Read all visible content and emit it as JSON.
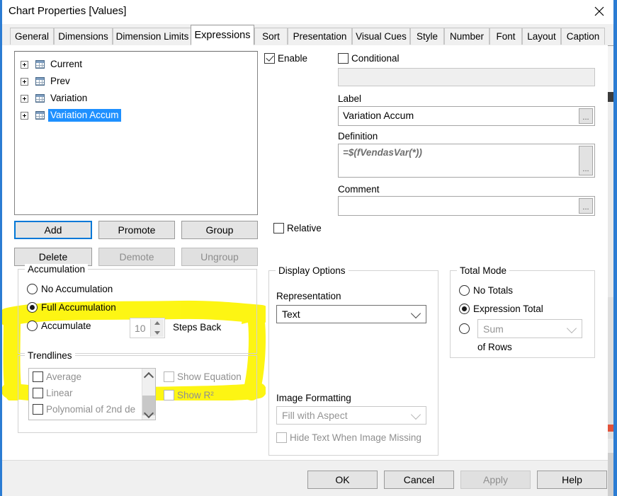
{
  "window": {
    "title": "Chart Properties [Values]",
    "close_icon": "close-icon"
  },
  "tabs": [
    {
      "label": "General",
      "active": false
    },
    {
      "label": "Dimensions",
      "active": false
    },
    {
      "label": "Dimension Limits",
      "active": false
    },
    {
      "label": "Expressions",
      "active": true
    },
    {
      "label": "Sort",
      "active": false
    },
    {
      "label": "Presentation",
      "active": false
    },
    {
      "label": "Visual Cues",
      "active": false
    },
    {
      "label": "Style",
      "active": false
    },
    {
      "label": "Number",
      "active": false
    },
    {
      "label": "Font",
      "active": false
    },
    {
      "label": "Layout",
      "active": false
    },
    {
      "label": "Caption",
      "active": false
    }
  ],
  "expression_tree": {
    "items": [
      {
        "label": "Current",
        "selected": false
      },
      {
        "label": "Prev",
        "selected": false
      },
      {
        "label": "Variation",
        "selected": false
      },
      {
        "label": "Variation Accum",
        "selected": true
      }
    ]
  },
  "action_buttons": {
    "add": "Add",
    "promote": "Promote",
    "group": "Group",
    "delete": "Delete",
    "demote": "Demote",
    "ungroup": "Ungroup"
  },
  "expression_detail": {
    "enable_label": "Enable",
    "enable_checked": true,
    "conditional_label": "Conditional",
    "conditional_checked": false,
    "conditional_value": "",
    "label_caption": "Label",
    "label_value": "Variation Accum",
    "definition_caption": "Definition",
    "definition_value": "=$(fVendasVar(*))",
    "comment_caption": "Comment",
    "comment_value": "",
    "ellipsis": "...",
    "relative_label": "Relative",
    "relative_checked": false
  },
  "accumulation": {
    "title": "Accumulation",
    "options": [
      {
        "label": "No Accumulation",
        "selected": false
      },
      {
        "label": "Full Accumulation",
        "selected": true
      },
      {
        "label": "Accumulate",
        "selected": false
      }
    ],
    "steps_value": "10",
    "steps_label": "Steps Back",
    "highlight_color": "#fdf500"
  },
  "trendlines": {
    "title": "Trendlines",
    "items": [
      {
        "label": "Average",
        "checked": false
      },
      {
        "label": "Linear",
        "checked": false
      },
      {
        "label": "Polynomial of 2nd de",
        "checked": false
      }
    ],
    "show_equation_label": "Show Equation",
    "show_equation_checked": false,
    "show_r2_label": "Show R²",
    "show_r2_checked": false
  },
  "display_options": {
    "title": "Display Options",
    "representation_caption": "Representation",
    "representation_value": "Text",
    "image_formatting_caption": "Image Formatting",
    "image_formatting_value": "Fill with Aspect",
    "hide_text_label": "Hide Text When Image Missing",
    "hide_text_checked": false
  },
  "total_mode": {
    "title": "Total Mode",
    "options": [
      {
        "label": "No Totals",
        "selected": false
      },
      {
        "label": "Expression Total",
        "selected": true
      }
    ],
    "aggregation_value": "Sum",
    "of_rows_label": "of Rows"
  },
  "footer": {
    "ok": "OK",
    "cancel": "Cancel",
    "apply": "Apply",
    "help": "Help"
  }
}
